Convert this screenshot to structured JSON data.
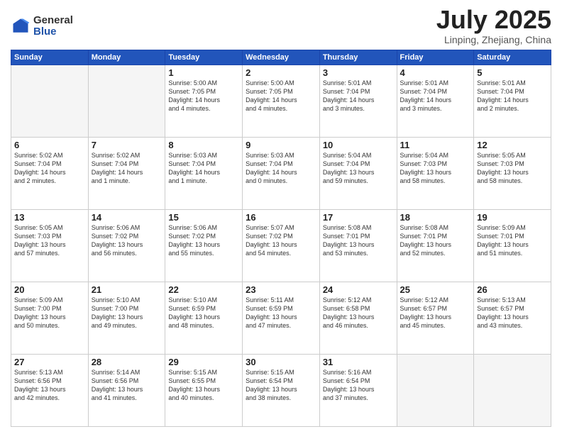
{
  "header": {
    "logo_general": "General",
    "logo_blue": "Blue",
    "month_title": "July 2025",
    "location": "Linping, Zhejiang, China"
  },
  "weekdays": [
    "Sunday",
    "Monday",
    "Tuesday",
    "Wednesday",
    "Thursday",
    "Friday",
    "Saturday"
  ],
  "weeks": [
    [
      {
        "day": "",
        "info": ""
      },
      {
        "day": "",
        "info": ""
      },
      {
        "day": "1",
        "info": "Sunrise: 5:00 AM\nSunset: 7:05 PM\nDaylight: 14 hours\nand 4 minutes."
      },
      {
        "day": "2",
        "info": "Sunrise: 5:00 AM\nSunset: 7:05 PM\nDaylight: 14 hours\nand 4 minutes."
      },
      {
        "day": "3",
        "info": "Sunrise: 5:01 AM\nSunset: 7:04 PM\nDaylight: 14 hours\nand 3 minutes."
      },
      {
        "day": "4",
        "info": "Sunrise: 5:01 AM\nSunset: 7:04 PM\nDaylight: 14 hours\nand 3 minutes."
      },
      {
        "day": "5",
        "info": "Sunrise: 5:01 AM\nSunset: 7:04 PM\nDaylight: 14 hours\nand 2 minutes."
      }
    ],
    [
      {
        "day": "6",
        "info": "Sunrise: 5:02 AM\nSunset: 7:04 PM\nDaylight: 14 hours\nand 2 minutes."
      },
      {
        "day": "7",
        "info": "Sunrise: 5:02 AM\nSunset: 7:04 PM\nDaylight: 14 hours\nand 1 minute."
      },
      {
        "day": "8",
        "info": "Sunrise: 5:03 AM\nSunset: 7:04 PM\nDaylight: 14 hours\nand 1 minute."
      },
      {
        "day": "9",
        "info": "Sunrise: 5:03 AM\nSunset: 7:04 PM\nDaylight: 14 hours\nand 0 minutes."
      },
      {
        "day": "10",
        "info": "Sunrise: 5:04 AM\nSunset: 7:04 PM\nDaylight: 13 hours\nand 59 minutes."
      },
      {
        "day": "11",
        "info": "Sunrise: 5:04 AM\nSunset: 7:03 PM\nDaylight: 13 hours\nand 58 minutes."
      },
      {
        "day": "12",
        "info": "Sunrise: 5:05 AM\nSunset: 7:03 PM\nDaylight: 13 hours\nand 58 minutes."
      }
    ],
    [
      {
        "day": "13",
        "info": "Sunrise: 5:05 AM\nSunset: 7:03 PM\nDaylight: 13 hours\nand 57 minutes."
      },
      {
        "day": "14",
        "info": "Sunrise: 5:06 AM\nSunset: 7:02 PM\nDaylight: 13 hours\nand 56 minutes."
      },
      {
        "day": "15",
        "info": "Sunrise: 5:06 AM\nSunset: 7:02 PM\nDaylight: 13 hours\nand 55 minutes."
      },
      {
        "day": "16",
        "info": "Sunrise: 5:07 AM\nSunset: 7:02 PM\nDaylight: 13 hours\nand 54 minutes."
      },
      {
        "day": "17",
        "info": "Sunrise: 5:08 AM\nSunset: 7:01 PM\nDaylight: 13 hours\nand 53 minutes."
      },
      {
        "day": "18",
        "info": "Sunrise: 5:08 AM\nSunset: 7:01 PM\nDaylight: 13 hours\nand 52 minutes."
      },
      {
        "day": "19",
        "info": "Sunrise: 5:09 AM\nSunset: 7:01 PM\nDaylight: 13 hours\nand 51 minutes."
      }
    ],
    [
      {
        "day": "20",
        "info": "Sunrise: 5:09 AM\nSunset: 7:00 PM\nDaylight: 13 hours\nand 50 minutes."
      },
      {
        "day": "21",
        "info": "Sunrise: 5:10 AM\nSunset: 7:00 PM\nDaylight: 13 hours\nand 49 minutes."
      },
      {
        "day": "22",
        "info": "Sunrise: 5:10 AM\nSunset: 6:59 PM\nDaylight: 13 hours\nand 48 minutes."
      },
      {
        "day": "23",
        "info": "Sunrise: 5:11 AM\nSunset: 6:59 PM\nDaylight: 13 hours\nand 47 minutes."
      },
      {
        "day": "24",
        "info": "Sunrise: 5:12 AM\nSunset: 6:58 PM\nDaylight: 13 hours\nand 46 minutes."
      },
      {
        "day": "25",
        "info": "Sunrise: 5:12 AM\nSunset: 6:57 PM\nDaylight: 13 hours\nand 45 minutes."
      },
      {
        "day": "26",
        "info": "Sunrise: 5:13 AM\nSunset: 6:57 PM\nDaylight: 13 hours\nand 43 minutes."
      }
    ],
    [
      {
        "day": "27",
        "info": "Sunrise: 5:13 AM\nSunset: 6:56 PM\nDaylight: 13 hours\nand 42 minutes."
      },
      {
        "day": "28",
        "info": "Sunrise: 5:14 AM\nSunset: 6:56 PM\nDaylight: 13 hours\nand 41 minutes."
      },
      {
        "day": "29",
        "info": "Sunrise: 5:15 AM\nSunset: 6:55 PM\nDaylight: 13 hours\nand 40 minutes."
      },
      {
        "day": "30",
        "info": "Sunrise: 5:15 AM\nSunset: 6:54 PM\nDaylight: 13 hours\nand 38 minutes."
      },
      {
        "day": "31",
        "info": "Sunrise: 5:16 AM\nSunset: 6:54 PM\nDaylight: 13 hours\nand 37 minutes."
      },
      {
        "day": "",
        "info": ""
      },
      {
        "day": "",
        "info": ""
      }
    ]
  ]
}
